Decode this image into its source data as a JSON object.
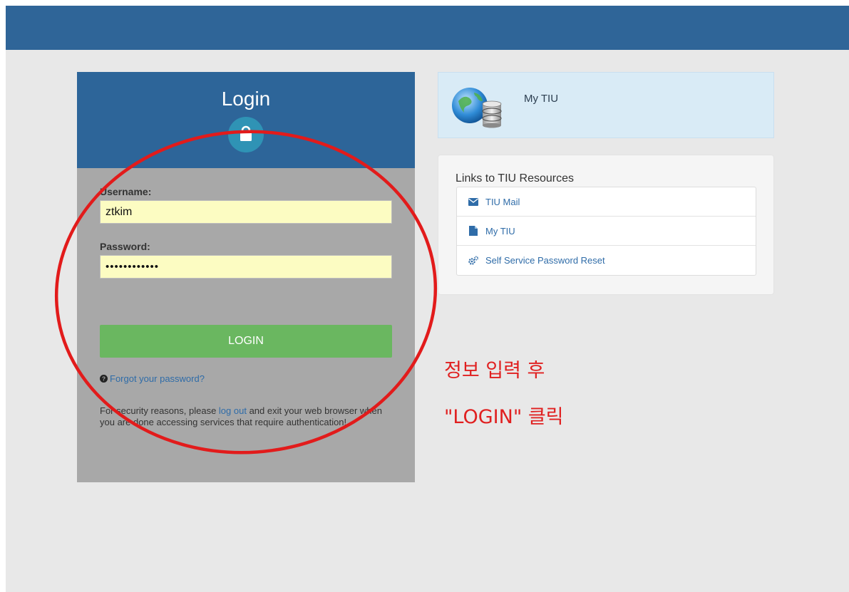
{
  "login": {
    "title": "Login",
    "username_label": "Username:",
    "username_value": "ztkim",
    "password_label": "Password:",
    "password_value": "••••••••••••",
    "button_label": "LOGIN",
    "forgot_link": "Forgot your password?",
    "note_before": "For security reasons, please ",
    "note_link": "log out",
    "note_after": " and exit your web browser when you are done accessing services that require authentication!"
  },
  "mytiu": {
    "title": "My TIU"
  },
  "resources": {
    "title": "Links to TIU Resources",
    "items": [
      {
        "label": "TIU Mail",
        "icon": "envelope-icon"
      },
      {
        "label": "My TIU",
        "icon": "document-icon"
      },
      {
        "label": "Self Service Password Reset",
        "icon": "gears-icon"
      }
    ]
  },
  "annotation": {
    "line1": "정보 입력 후",
    "line2": "\"LOGIN\" 클릭",
    "color": "#e02020"
  },
  "colors": {
    "topbar": "#2f6598",
    "login_header": "#2d6599",
    "login_button": "#6ab760",
    "input_bg": "#fcfcc2",
    "link": "#2f6ca8"
  }
}
